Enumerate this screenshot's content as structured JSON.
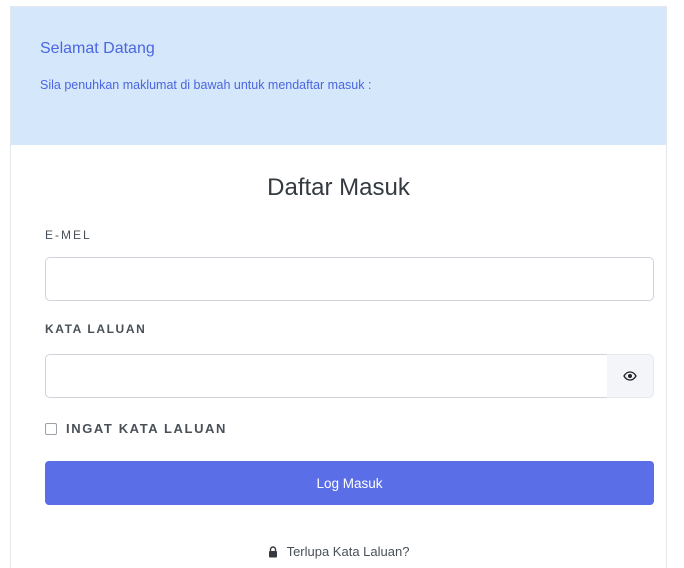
{
  "welcome": {
    "title": "Selamat Datang",
    "subtitle": "Sila penuhkan maklumat di bawah untuk mendaftar masuk :"
  },
  "form": {
    "title": "Daftar Masuk",
    "email_label": "E-MEL",
    "email_value": "",
    "password_label": "KATA LALUAN",
    "password_value": "",
    "toggle_icon": "eye-icon",
    "remember_label": "INGAT KATA LALUAN",
    "remember_checked": false,
    "submit_label": "Log Masuk",
    "forgot_label": "Terlupa Kata Laluan?",
    "forgot_icon": "lock-icon"
  },
  "colors": {
    "banner_bg": "#d4e7fb",
    "accent_text": "#4b66e0",
    "button_bg": "#5a6ee8"
  }
}
